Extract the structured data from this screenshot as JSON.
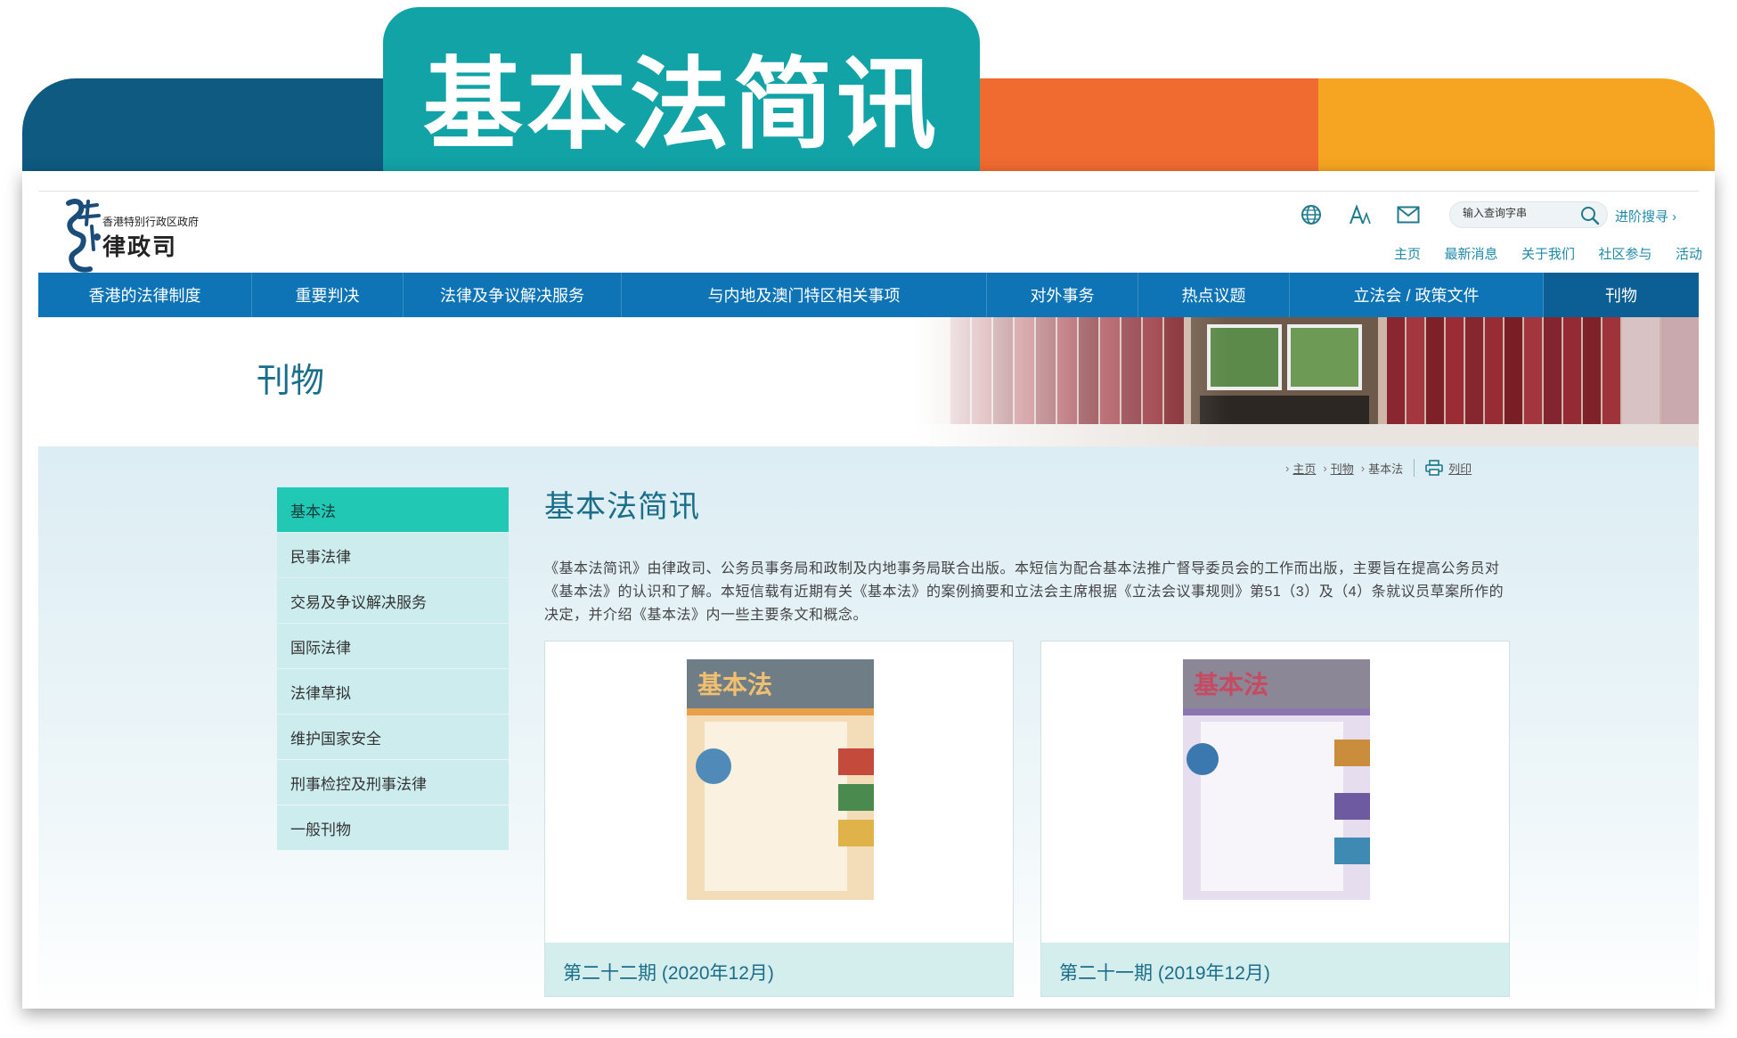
{
  "banner": {
    "title": "基本法简讯"
  },
  "header": {
    "org_line1": "香港特别行政区政府",
    "org_line2": "律政司",
    "search_placeholder": "输入查询字串",
    "advanced_search": "进阶搜寻 ›",
    "icons": [
      "globe-icon",
      "font-size-icon",
      "mail-icon",
      "search-icon"
    ],
    "top_links": [
      "主页",
      "最新消息",
      "关于我们",
      "社区参与",
      "活动"
    ]
  },
  "nav": {
    "items": [
      "香港的法律制度",
      "重要判决",
      "法律及争议解决服务",
      "与内地及澳门特区相关事项",
      "对外事务",
      "热点议题",
      "立法会 / 政策文件",
      "刊物"
    ],
    "active_index": 7
  },
  "page": {
    "section_title": "刊物"
  },
  "breadcrumb": {
    "items": [
      "主页",
      "刊物",
      "基本法"
    ],
    "print": "列印"
  },
  "sidebar": {
    "items": [
      "基本法",
      "民事法律",
      "交易及争议解决服务",
      "国际法律",
      "法律草拟",
      "维护国家安全",
      "刑事检控及刑事法律",
      "一般刊物"
    ],
    "active_index": 0
  },
  "main": {
    "heading": "基本法简讯",
    "intro": "《基本法简讯》由律政司、公务员事务局和政制及内地事务局联合出版。本短信为配合基本法推广督导委员会的工作而出版，主要旨在提高公务员对《基本法》的认识和了解。本短信载有近期有关《基本法》的案例摘要和立法会主席根据《立法会议事规则》第51（3）及（4）条就议员草案所作的决定，并介绍《基本法》内一些主要条文和概念。",
    "issues": [
      {
        "label": "第二十二期 (2020年12月)",
        "cover_title": "基本法"
      },
      {
        "label": "第二十一期 (2019年12月)",
        "cover_title": "基本法"
      }
    ]
  },
  "colors": {
    "nav_blue": "#0e74b6",
    "teal_tab": "#12a3a7",
    "sidebar_active": "#21c8b4",
    "heading_teal": "#1a6e8a"
  }
}
